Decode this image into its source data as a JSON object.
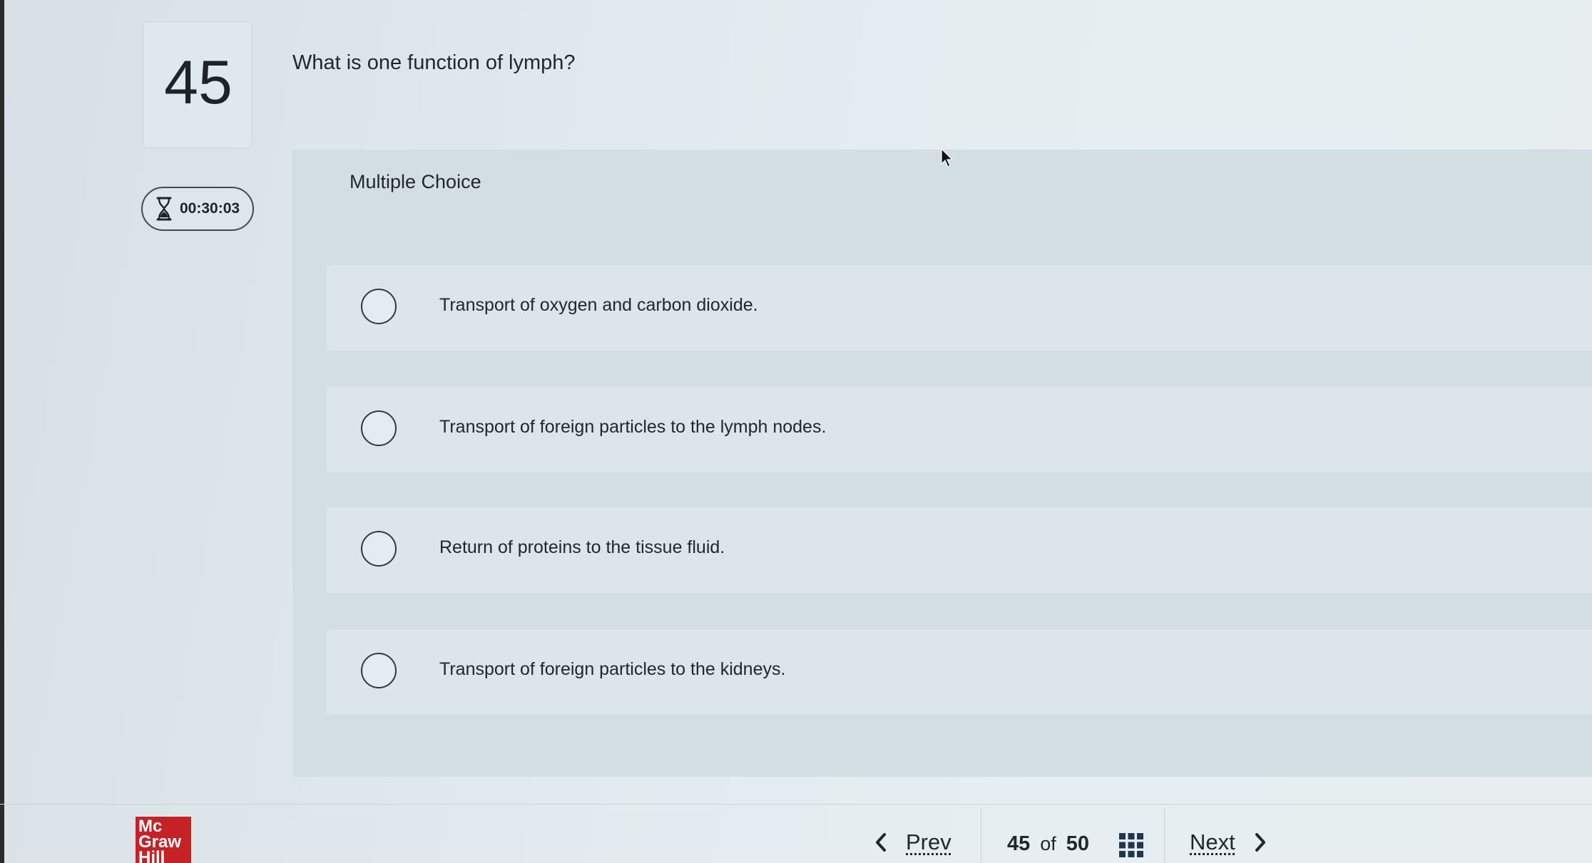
{
  "question": {
    "number": "45",
    "text": "What is one function of lymph?",
    "type_label": "Multiple Choice"
  },
  "timer": {
    "icon": "hourglass-icon",
    "value": "00:30:03"
  },
  "options": [
    {
      "label": "Transport of oxygen and carbon dioxide.",
      "selected": false
    },
    {
      "label": "Transport of foreign particles to the lymph nodes.",
      "selected": false
    },
    {
      "label": "Return of proteins to the tissue fluid.",
      "selected": false
    },
    {
      "label": "Transport of foreign particles to the kidneys.",
      "selected": false
    }
  ],
  "logo": {
    "brand": "McGraw Hill",
    "lines": [
      "Mc",
      "Graw",
      "Hill"
    ],
    "color": "#c62127"
  },
  "navigation": {
    "prev_label": "Prev",
    "next_label": "Next",
    "current_page": "45",
    "of_label": "of",
    "total_pages": "50",
    "grid_icon": "question-grid-icon"
  },
  "colors": {
    "background": "#dde7ec",
    "panel": "#d3dee3",
    "option_bg": "#dbe5ea",
    "text": "#1f272b"
  }
}
